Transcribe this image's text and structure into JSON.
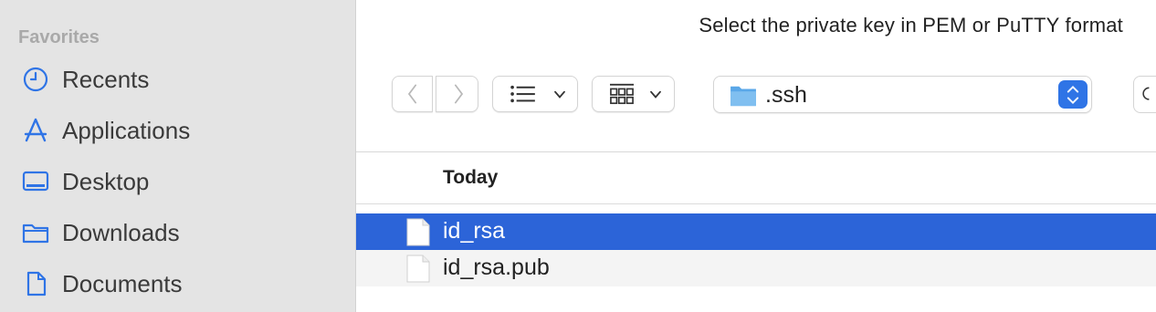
{
  "dialog": {
    "prompt": "Select the private key in PEM or PuTTY format"
  },
  "sidebar": {
    "heading": "Favorites",
    "items": [
      {
        "label": "Recents",
        "icon": "clock-icon"
      },
      {
        "label": "Applications",
        "icon": "applications-icon"
      },
      {
        "label": "Desktop",
        "icon": "desktop-icon"
      },
      {
        "label": "Downloads",
        "icon": "folder-icon"
      },
      {
        "label": "Documents",
        "icon": "document-icon"
      }
    ]
  },
  "toolbar": {
    "back": "back",
    "forward": "forward",
    "list_view": "list-view",
    "group_view": "grid-view",
    "path": ".ssh"
  },
  "file_list": {
    "group_header": "Today",
    "files": [
      {
        "name": "id_rsa",
        "selected": true
      },
      {
        "name": "id_rsa.pub",
        "selected": false
      }
    ]
  },
  "colors": {
    "accent": "#2f74e6",
    "selection": "#2c64d8",
    "sidebar_bg": "#e4e4e4",
    "sidebar_icon": "#2f74e6"
  }
}
